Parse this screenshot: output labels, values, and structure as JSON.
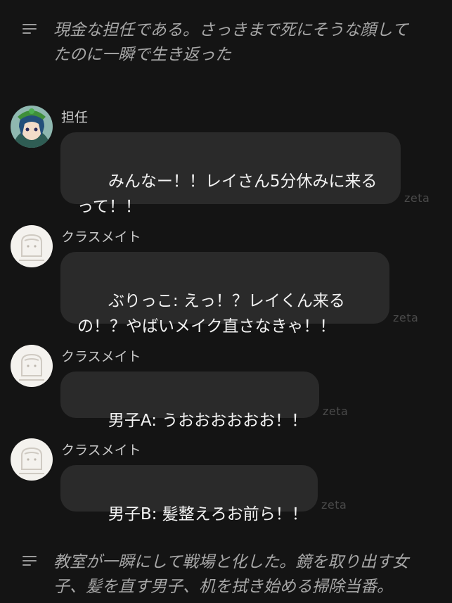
{
  "narration_top": {
    "text": "現金な担任である。さっきまで死にそうな顔して\nたのに一瞬で生き返った"
  },
  "messages": [
    {
      "speaker": "担任",
      "text": "みんなー！！レイさん5分休みに来る\nって！！",
      "watermark": "zeta",
      "avatar": "green-hat-character-icon"
    },
    {
      "speaker": "クラスメイト",
      "text": "ぶりっこ: えっ！？レイくん来る\nの！？やばいメイク直さなきゃ！！",
      "watermark": "zeta",
      "avatar": "classmate-placeholder-icon"
    },
    {
      "speaker": "クラスメイト",
      "text": "男子A: うおおおおおお！！",
      "watermark": "zeta",
      "avatar": "classmate-placeholder-icon"
    },
    {
      "speaker": "クラスメイト",
      "text": "男子B: 髪整えろお前ら！！",
      "watermark": "zeta",
      "avatar": "classmate-placeholder-icon"
    }
  ],
  "narration_bottom": {
    "text": "教室が一瞬にして戦場と化した。鏡を取り出す女\n子、髪を直す男子、机を拭き始める掃除当番。"
  },
  "colors": {
    "background": "#141414",
    "bubble": "#2a2a2a",
    "narration_text": "#a7a7a7",
    "speaker_text": "#c9c9c9"
  }
}
